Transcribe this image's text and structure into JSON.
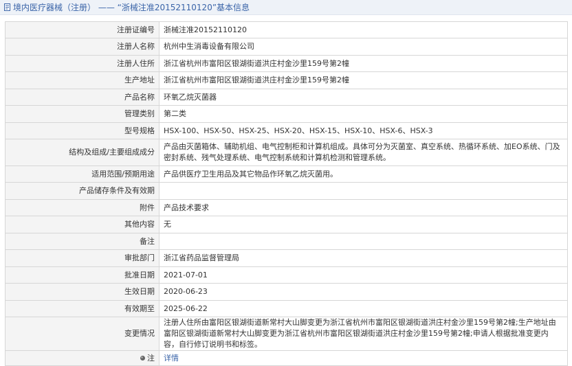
{
  "header": {
    "title": "境内医疗器械（注册） —— “浙械注准20152110120”基本信息"
  },
  "fields": {
    "reg_no": {
      "label": "注册证编号",
      "value": "浙械注准20152110120"
    },
    "registrant": {
      "label": "注册人名称",
      "value": "杭州中生消毒设备有限公司"
    },
    "registrant_address": {
      "label": "注册人住所",
      "value": "浙江省杭州市富阳区银湖街道洪庄村金沙里159号第2幢"
    },
    "production_address": {
      "label": "生产地址",
      "value": "浙江省杭州市富阳区银湖街道洪庄村金沙里159号第2幢"
    },
    "product_name": {
      "label": "产品名称",
      "value": "环氧乙烷灭菌器"
    },
    "category": {
      "label": "管理类别",
      "value": "第二类"
    },
    "model": {
      "label": "型号规格",
      "value": "HSX-100、HSX-50、HSX-25、HSX-20、HSX-15、HSX-10、HSX-6、HSX-3"
    },
    "structure": {
      "label": "结构及组成/主要组成成分",
      "value": "产品由灭菌箱体、辅助机组、电气控制柜和计算机组成。具体可分为灭菌室、真空系统、热循环系统、加EO系统、门及密封系统、残气处理系统、电气控制系统和计算机检测和管理系统。"
    },
    "scope": {
      "label": "适用范围/预期用途",
      "value": "产品供医疗卫生用品及其它物品作环氧乙烷灭菌用。"
    },
    "storage": {
      "label": "产品储存条件及有效期",
      "value": ""
    },
    "attachment": {
      "label": "附件",
      "value": "产品技术要求"
    },
    "other": {
      "label": "其他内容",
      "value": "无"
    },
    "remark": {
      "label": "备注",
      "value": ""
    },
    "approval_dept": {
      "label": "审批部门",
      "value": "浙江省药品监督管理局"
    },
    "approval_date": {
      "label": "批准日期",
      "value": "2021-07-01"
    },
    "effective_date": {
      "label": "生效日期",
      "value": "2020-06-23"
    },
    "expiry_date": {
      "label": "有效期至",
      "value": "2025-06-22"
    },
    "change_info": {
      "label": "变更情况",
      "value": "注册人住所由富阳区银湖街道新常村大山脚变更为浙江省杭州市富阳区银湖街道洪庄村金沙里159号第2幢;生产地址由富阳区银湖街道新常村大山脚变更为浙江省杭州市富阳区银湖街道洪庄村金沙里159号第2幢;申请人根据批准变更内容，自行修订说明书和标签。"
    }
  },
  "footer": {
    "note_label": "注",
    "detail_link": "详情"
  },
  "icons": {
    "title_icon": "document-icon",
    "note_icon": "pin-icon"
  },
  "colors": {
    "link": "#3a64a8",
    "label_bg": "#f4f4f4",
    "header_bg": "#eef2f8",
    "border": "#d6d6d6"
  }
}
